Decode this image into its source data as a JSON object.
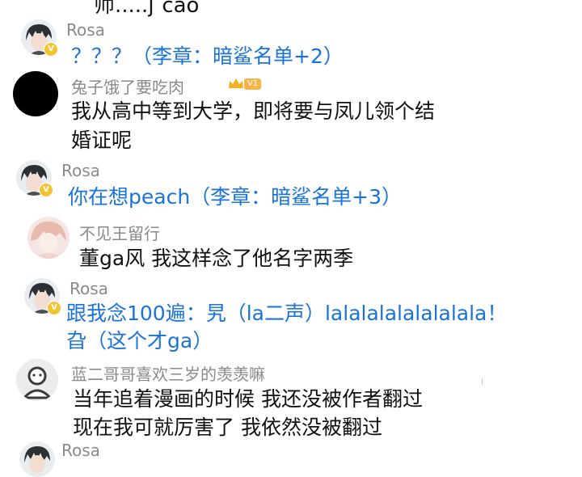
{
  "cut_top_text": "师.....ʃ cao",
  "entries": [
    {
      "user": "Rosa",
      "lines": [
        "？？？（李章：暗鲨名单+2）"
      ]
    },
    {
      "user": "兔子饿了要吃肉",
      "badge": "V1",
      "lines": [
        "我从高中等到大学，即将要与凤儿领个结",
        "婚证呢"
      ]
    },
    {
      "user": "Rosa",
      "lines": [
        "你在想peach（李章：暗鲨名单+3）"
      ]
    },
    {
      "user": "不见王留行",
      "lines": [
        "董ga风 我这样念了他名字两季"
      ]
    },
    {
      "user": "Rosa",
      "lines": [
        "跟我念100遍：旯（la二声）lalalalalalalalala！",
        "旮（这个才ga）"
      ]
    },
    {
      "user": "蓝二哥哥喜欢三岁的羡羡嘛",
      "lines": [
        "当年追着漫画的时候 我还没被作者翻过",
        "现在我可就厉害了 我依然没被翻过"
      ]
    },
    {
      "user": "Rosa",
      "lines": []
    }
  ],
  "colors": {
    "blue_text": "#1a73d9",
    "name_gray": "#8a8a8a",
    "v_badge": "#f4c430"
  },
  "icons": [
    "rosa-avatar",
    "v-verified-badge",
    "black-avatar",
    "crown-icon",
    "level-badge",
    "anime-avatar",
    "default-user-avatar"
  ]
}
